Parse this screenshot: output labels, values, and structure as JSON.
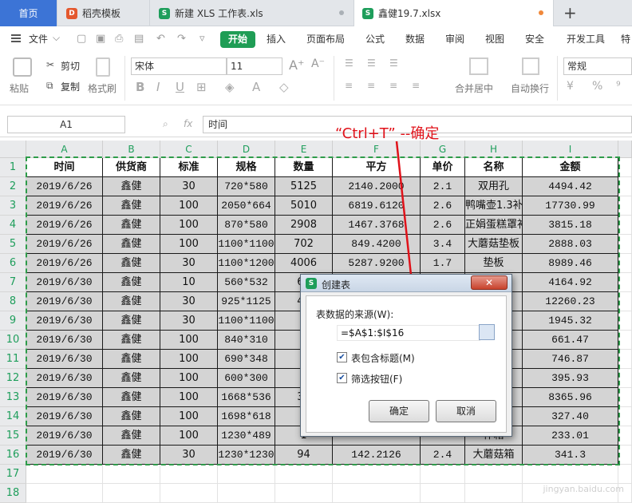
{
  "tabs": {
    "home": "首页",
    "t1": "稻壳模板",
    "t2": "新建 XLS 工作表.xls",
    "t3": "鑫健19.7.xlsx"
  },
  "menu": {
    "file": "文件",
    "items": [
      "开始",
      "插入",
      "页面布局",
      "公式",
      "数据",
      "审阅",
      "视图",
      "安全",
      "开发工具",
      "特"
    ]
  },
  "ribbon": {
    "paste": "粘贴",
    "cut": "剪切",
    "copy": "复制",
    "format_painter": "格式刷",
    "font_name": "宋体",
    "font_size": "11",
    "merge": "合并居中",
    "wrap": "自动换行",
    "number_format": "常规"
  },
  "formula_bar": {
    "cell_ref": "A1",
    "fx": "fx",
    "content": "时间"
  },
  "annotation": "“Ctrl+T”  --确定",
  "columns": [
    "A",
    "B",
    "C",
    "D",
    "E",
    "F",
    "G",
    "H",
    "I"
  ],
  "rows": [
    [
      "时间",
      "供货商",
      "标准",
      "规格",
      "数量",
      "平方",
      "单价",
      "名称",
      "金额"
    ],
    [
      "2019/6/26",
      "鑫健",
      "30",
      "720*580",
      "5125",
      "2140.2000",
      "2.1",
      "双用孔",
      "4494.42"
    ],
    [
      "2019/6/26",
      "鑫健",
      "100",
      "2050*664",
      "5010",
      "6819.6120",
      "2.6",
      "鸭嘴壶1.3补",
      "17730.99"
    ],
    [
      "2019/6/26",
      "鑫健",
      "100",
      "870*580",
      "2908",
      "1467.3768",
      "2.6",
      "正娟蛋糕罩补",
      "3815.18"
    ],
    [
      "2019/6/26",
      "鑫健",
      "100",
      "1100*1100",
      "702",
      "849.4200",
      "3.4",
      "大蘑菇垫板",
      "2888.03"
    ],
    [
      "2019/6/26",
      "鑫健",
      "30",
      "1100*1200",
      "4006",
      "5287.9200",
      "1.7",
      "垫板",
      "8989.46"
    ],
    [
      "2019/6/30",
      "鑫健",
      "10",
      "560*532",
      "69",
      "",
      "",
      "根",
      "4164.92"
    ],
    [
      "2019/6/30",
      "鑫健",
      "30",
      "925*1125",
      "49",
      "",
      "",
      "箱",
      "12260.23"
    ],
    [
      "2019/6/30",
      "鑫健",
      "30",
      "1100*1100",
      "6",
      "",
      "",
      "",
      "1945.32"
    ],
    [
      "2019/6/30",
      "鑫健",
      "100",
      "840*310",
      "9",
      "",
      "",
      "",
      "661.47"
    ],
    [
      "2019/6/30",
      "鑫健",
      "100",
      "690*348",
      "1",
      "",
      "",
      "垫",
      "746.87"
    ],
    [
      "2019/6/30",
      "鑫健",
      "100",
      "600*300",
      "8",
      "",
      "",
      "垫",
      "395.93"
    ],
    [
      "2019/6/30",
      "鑫健",
      "100",
      "1668*536",
      "35",
      "",
      "",
      "25",
      "8365.96"
    ],
    [
      "2019/6/30",
      "鑫健",
      "100",
      "1698*618",
      "1",
      "",
      "",
      "荣",
      "327.40"
    ],
    [
      "2019/6/30",
      "鑫健",
      "100",
      "1230*489",
      "1",
      "",
      "",
      "作箱",
      "233.01"
    ],
    [
      "2019/6/30",
      "鑫健",
      "30",
      "1230*1230",
      "94",
      "142.2126",
      "2.4",
      "大蘑菇箱",
      "341.3"
    ]
  ],
  "row_numbers": [
    "1",
    "2",
    "3",
    "4",
    "5",
    "6",
    "7",
    "8",
    "9",
    "10",
    "11",
    "12",
    "13",
    "14",
    "15",
    "16",
    "17",
    "18"
  ],
  "dialog": {
    "title": "创建表",
    "source_label": "表数据的来源(W):",
    "source_value": "=$A$1:$I$16",
    "has_header": "表包含标题(M)",
    "filter_button": "筛选按钮(F)",
    "ok": "确定",
    "cancel": "取消"
  },
  "watermark": "jingyan.baidu.com",
  "colors": {
    "accent": "#1f9d55",
    "tab_home": "#3c74d6",
    "annotation": "#e0121a"
  }
}
